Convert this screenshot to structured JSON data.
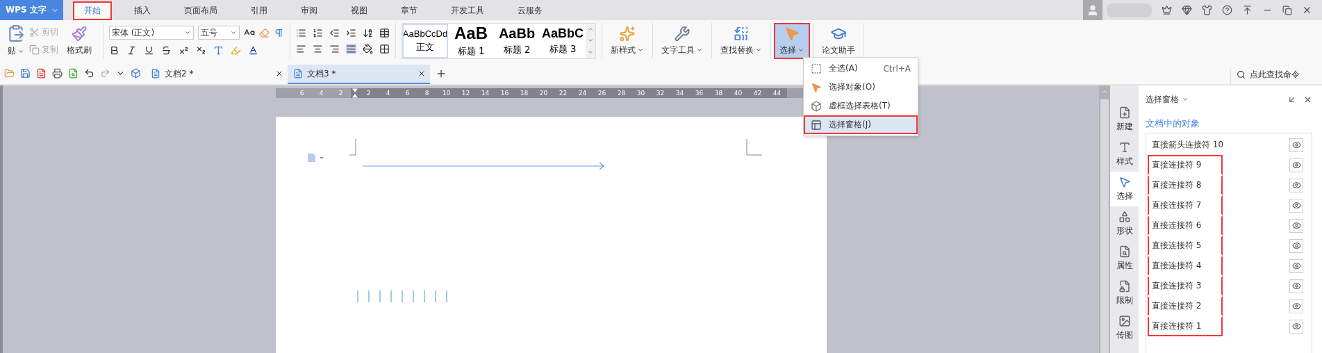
{
  "app_button": {
    "label": "WPS 文字"
  },
  "menu_tabs": [
    {
      "label": "开始",
      "selected": true,
      "outlined": true
    },
    {
      "label": "插入",
      "selected": false,
      "outlined": false
    },
    {
      "label": "页面布局",
      "selected": false,
      "outlined": false
    },
    {
      "label": "引用",
      "selected": false,
      "outlined": false
    },
    {
      "label": "审阅",
      "selected": false,
      "outlined": false
    },
    {
      "label": "视图",
      "selected": false,
      "outlined": false
    },
    {
      "label": "章节",
      "selected": false,
      "outlined": false
    },
    {
      "label": "开发工具",
      "selected": false,
      "outlined": false
    },
    {
      "label": "云服务",
      "selected": false,
      "outlined": false
    }
  ],
  "ribbon": {
    "clipboard": [
      {
        "label": "贴",
        "kind": "paste",
        "disabled": false
      },
      {
        "label": "剪切",
        "kind": "cut",
        "disabled": true
      },
      {
        "label": "复制",
        "kind": "copy",
        "disabled": true
      },
      {
        "label": "格式刷",
        "kind": "painter",
        "disabled": false
      }
    ],
    "font": {
      "name": "宋体 (正文)",
      "size": "五号"
    },
    "styles": [
      {
        "preview": "AaBbCcDd",
        "label": "正文",
        "kind": "body",
        "selected": true
      },
      {
        "preview": "AaB",
        "label": "标题 1",
        "kind": "heading1",
        "selected": false
      },
      {
        "preview": "AaBb",
        "label": "标题 2",
        "kind": "heading2",
        "selected": false
      },
      {
        "preview": "AaBbC",
        "label": "标题 3",
        "kind": "heading3",
        "selected": false
      }
    ],
    "buttons": [
      {
        "label": "新样式",
        "kind": "new-style",
        "selected": false,
        "outlined": false
      },
      {
        "label": "文字工具",
        "kind": "text-tools",
        "selected": false,
        "outlined": false
      },
      {
        "label": "查找替换",
        "kind": "find-replace",
        "selected": false,
        "outlined": false
      },
      {
        "label": "选择",
        "kind": "select",
        "selected": true,
        "outlined": true
      },
      {
        "label": "论文助手",
        "kind": "thesis",
        "selected": false,
        "outlined": false
      }
    ]
  },
  "doc_tabs": [
    {
      "label": "文档2 *",
      "selected": false
    },
    {
      "label": "文档3 *",
      "selected": true
    }
  ],
  "command_search": {
    "placeholder": "点此查找命令"
  },
  "ruler": {
    "numbers_before": [
      "6",
      "4",
      "2"
    ],
    "numbers_after": [
      "2",
      "4",
      "6",
      "8",
      "10",
      "12",
      "14",
      "16",
      "18",
      "20",
      "22",
      "24",
      "26",
      "28",
      "30",
      "32",
      "34",
      "36",
      "38",
      "40",
      "42",
      "44"
    ]
  },
  "select_menu": [
    {
      "label": "全选(A)",
      "shortcut": "Ctrl+A",
      "kind": "select-all",
      "selected": false,
      "outlined": false
    },
    {
      "label": "选择对象(O)",
      "kind": "select-object",
      "selected": false,
      "outlined": false
    },
    {
      "label": "虚框选择表格(T)",
      "kind": "select-table",
      "selected": false,
      "outlined": false
    },
    {
      "label": "选择窗格(J)",
      "kind": "selection-pane",
      "selected": true,
      "outlined": true
    }
  ],
  "side_tabs": [
    {
      "label": "新建",
      "kind": "new",
      "selected": false
    },
    {
      "label": "样式",
      "kind": "style",
      "selected": false
    },
    {
      "label": "选择",
      "kind": "select",
      "selected": true
    },
    {
      "label": "形状",
      "kind": "shape",
      "selected": false
    },
    {
      "label": "属性",
      "kind": "property",
      "selected": false
    },
    {
      "label": "限制",
      "kind": "restrict",
      "selected": false
    },
    {
      "label": "传图",
      "kind": "image",
      "selected": false
    }
  ],
  "selection_pane": {
    "title": "选择窗格",
    "section": "文档中的对象",
    "objects": [
      {
        "name": "直接箭头连接符 10",
        "visible": true,
        "outlined": false
      },
      {
        "name": "直接连接符 9",
        "visible": true,
        "outlined": true
      },
      {
        "name": "直接连接符 8",
        "visible": true,
        "outlined": true
      },
      {
        "name": "直接连接符 7",
        "visible": true,
        "outlined": true
      },
      {
        "name": "直接连接符 6",
        "visible": true,
        "outlined": true
      },
      {
        "name": "直接连接符 5",
        "visible": true,
        "outlined": true
      },
      {
        "name": "直接连接符 4",
        "visible": true,
        "outlined": true
      },
      {
        "name": "直接连接符 3",
        "visible": true,
        "outlined": true
      },
      {
        "name": "直接连接符 2",
        "visible": true,
        "outlined": true
      },
      {
        "name": "直接连接符 1",
        "visible": true,
        "outlined": true
      }
    ]
  }
}
